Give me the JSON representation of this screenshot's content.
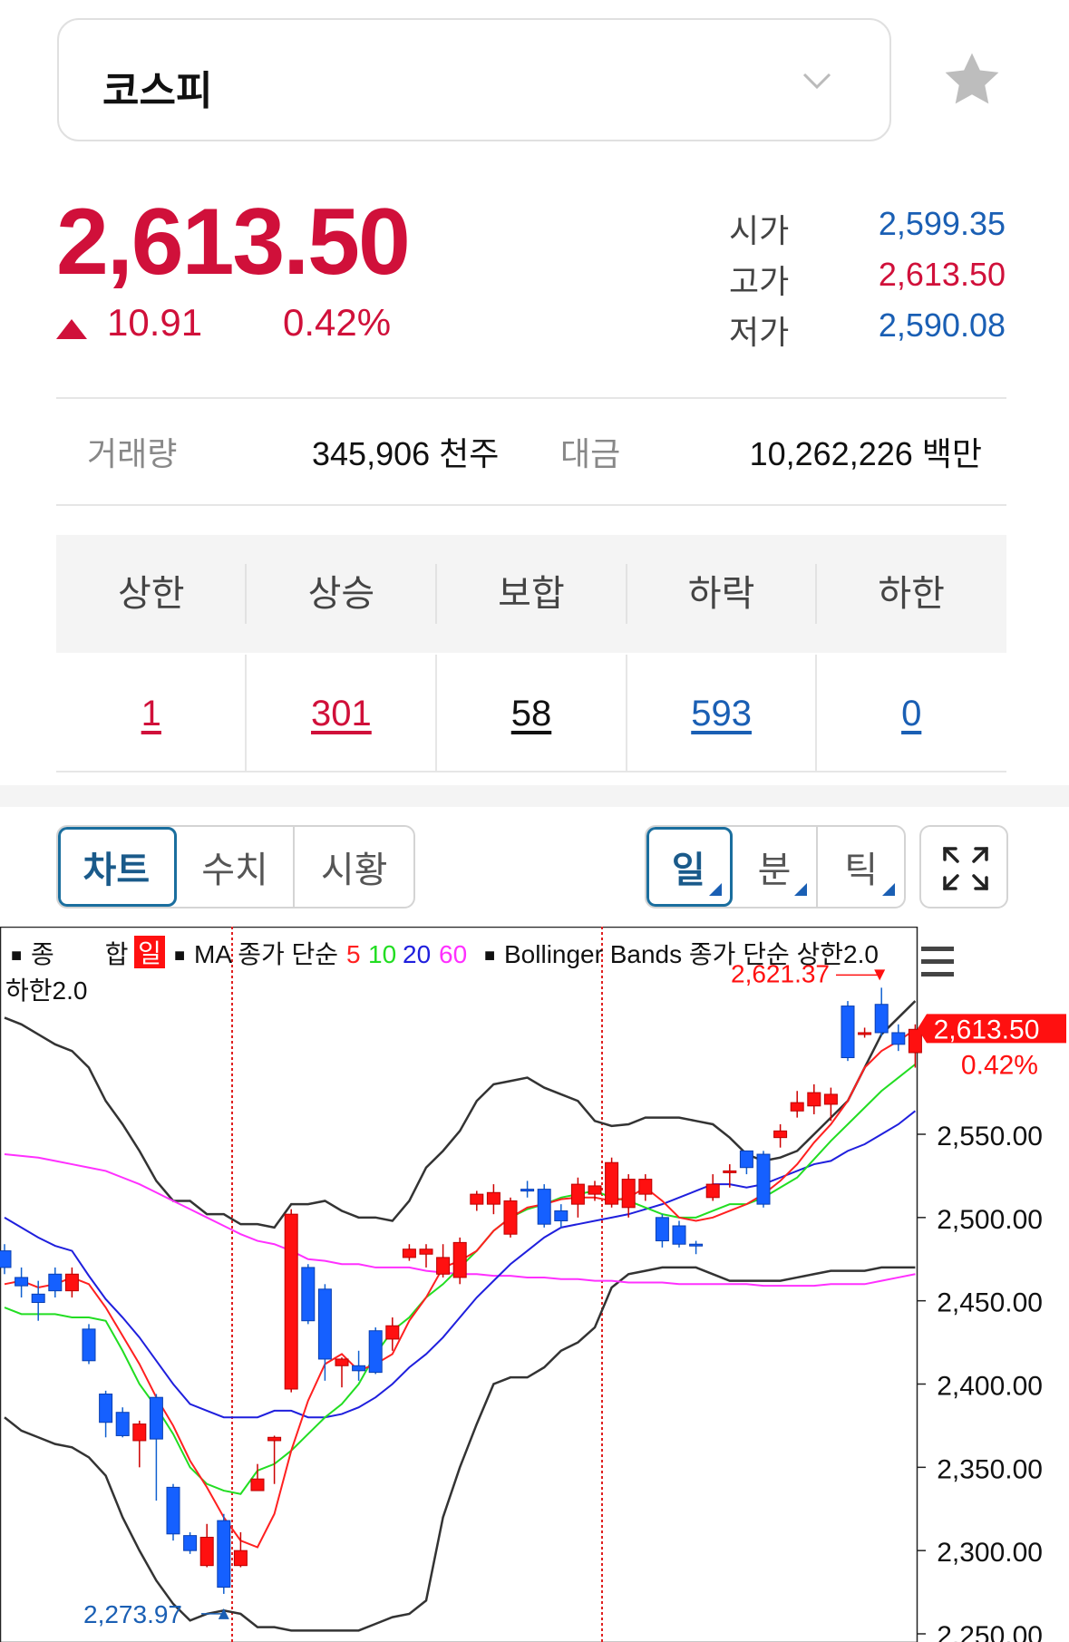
{
  "index": {
    "name": "코스피",
    "price": "2,613.50",
    "change": "10.91",
    "change_pct": "0.42%",
    "up_color": "#d0103a",
    "down_color": "#1a5fb4"
  },
  "ohl": {
    "open_label": "시가",
    "open": "2,599.35",
    "high_label": "고가",
    "high": "2,613.50",
    "low_label": "저가",
    "low": "2,590.08"
  },
  "volume": {
    "volume_label": "거래량",
    "volume": "345,906 천주",
    "amount_label": "대금",
    "amount": "10,262,226 백만"
  },
  "breadth": {
    "headers": [
      "상한",
      "상승",
      "보합",
      "하락",
      "하한"
    ],
    "values": [
      "1",
      "301",
      "58",
      "593",
      "0"
    ]
  },
  "view_tabs": [
    "차트",
    "수치",
    "시황"
  ],
  "period_tabs": [
    "일",
    "분",
    "틱"
  ],
  "chart_data": {
    "type": "candlestick",
    "legend": {
      "series_name": "종　　합",
      "period_badge": "일",
      "ma_text": "MA 종가 단순",
      "ma_periods": [
        "5",
        "10",
        "20",
        "60"
      ],
      "bb_text": "Bollinger Bands 종가 단순 상한2.0",
      "bb_text2": "하한2.0"
    },
    "ma_colors": [
      "#ff2020",
      "#22dd22",
      "#1f1fdd",
      "#ff30ff"
    ],
    "y_ticks": [
      "2,550.00",
      "2,500.00",
      "2,450.00",
      "2,400.00",
      "2,350.00",
      "2,300.00",
      "2,250.00"
    ],
    "y_tick_values": [
      2550,
      2500,
      2450,
      2400,
      2350,
      2300,
      2250
    ],
    "ylim": [
      2244,
      2648
    ],
    "last_price_label": "2,613.50",
    "last_pct_label": "0.42%",
    "max_label": "2,621.37",
    "min_label": "2,273.97",
    "candles": [
      [
        2480,
        2470,
        2484,
        2466
      ],
      [
        2464,
        2459,
        2470,
        2452
      ],
      [
        2454,
        2449,
        2462,
        2438
      ],
      [
        2466,
        2456,
        2470,
        2452
      ],
      [
        2456,
        2466,
        2470,
        2452
      ],
      [
        2433,
        2414,
        2436,
        2412
      ],
      [
        2394,
        2377,
        2396,
        2368
      ],
      [
        2383,
        2369,
        2386,
        2368
      ],
      [
        2366,
        2376,
        2378,
        2350
      ],
      [
        2392,
        2367,
        2394,
        2330
      ],
      [
        2338,
        2310,
        2340,
        2306
      ],
      [
        2309,
        2300,
        2311,
        2298
      ],
      [
        2291,
        2308,
        2316,
        2290
      ],
      [
        2318,
        2278,
        2322,
        2274
      ],
      [
        2291,
        2300,
        2311,
        2290
      ],
      [
        2336,
        2343,
        2352,
        2336
      ],
      [
        2366,
        2368,
        2369,
        2340
      ],
      [
        2397,
        2502,
        2505,
        2395
      ],
      [
        2470,
        2438,
        2472,
        2436
      ],
      [
        2457,
        2415,
        2460,
        2402
      ],
      [
        2411,
        2415,
        2416,
        2398
      ],
      [
        2411,
        2408,
        2420,
        2402
      ],
      [
        2432,
        2407,
        2434,
        2406
      ],
      [
        2427,
        2435,
        2440,
        2420
      ],
      [
        2476,
        2481,
        2484,
        2474
      ],
      [
        2478,
        2481,
        2484,
        2470
      ],
      [
        2466,
        2476,
        2484,
        2464
      ],
      [
        2464,
        2485,
        2488,
        2460
      ],
      [
        2508,
        2514,
        2516,
        2504
      ],
      [
        2508,
        2515,
        2520,
        2502
      ],
      [
        2490,
        2510,
        2512,
        2488
      ],
      [
        2517,
        2516,
        2522,
        2512
      ],
      [
        2517,
        2496,
        2520,
        2494
      ],
      [
        2504,
        2498,
        2508,
        2494
      ],
      [
        2508,
        2520,
        2524,
        2500
      ],
      [
        2514,
        2519,
        2522,
        2510
      ],
      [
        2508,
        2533,
        2536,
        2506
      ],
      [
        2506,
        2523,
        2526,
        2500
      ],
      [
        2514,
        2523,
        2526,
        2510
      ],
      [
        2500,
        2486,
        2502,
        2482
      ],
      [
        2495,
        2484,
        2498,
        2482
      ],
      [
        2484,
        2483,
        2486,
        2478
      ],
      [
        2512,
        2520,
        2526,
        2510
      ],
      [
        2528,
        2528,
        2532,
        2518
      ],
      [
        2540,
        2530,
        2540,
        2526
      ],
      [
        2538,
        2508,
        2540,
        2506
      ],
      [
        2548,
        2552,
        2556,
        2542
      ],
      [
        2564,
        2569,
        2576,
        2560
      ],
      [
        2567,
        2575,
        2580,
        2562
      ],
      [
        2568,
        2574,
        2578,
        2558
      ],
      [
        2627,
        2596,
        2630,
        2594
      ],
      [
        2610,
        2611,
        2614,
        2608
      ],
      [
        2628,
        2611,
        2638,
        2609
      ],
      [
        2611,
        2604,
        2616,
        2600
      ],
      [
        2599,
        2613,
        2616,
        2590
      ]
    ],
    "ma5": [
      2460,
      2462,
      2458,
      2460,
      2464,
      2460,
      2446,
      2429,
      2412,
      2392,
      2375,
      2354,
      2338,
      2320,
      2306,
      2302,
      2322,
      2360,
      2390,
      2412,
      2418,
      2408,
      2412,
      2418,
      2438,
      2452,
      2470,
      2474,
      2480,
      2492,
      2500,
      2506,
      2508,
      2511,
      2512,
      2512,
      2510,
      2512,
      2518,
      2510,
      2500,
      2498,
      2500,
      2504,
      2508,
      2514,
      2522,
      2532,
      2545,
      2556,
      2570,
      2590,
      2600,
      2606,
      2613
    ],
    "ma10": [
      2446,
      2442,
      2442,
      2442,
      2440,
      2440,
      2438,
      2420,
      2400,
      2386,
      2370,
      2350,
      2340,
      2336,
      2334,
      2348,
      2352,
      2360,
      2370,
      2380,
      2388,
      2400,
      2418,
      2432,
      2440,
      2452,
      2460,
      2470,
      2480,
      2492,
      2500,
      2505,
      2508,
      2512,
      2514,
      2516,
      2512,
      2510,
      2506,
      2502,
      2500,
      2500,
      2504,
      2508,
      2508,
      2512,
      2518,
      2524,
      2535,
      2546,
      2556,
      2566,
      2576,
      2584,
      2592
    ],
    "ma20": [
      2500,
      2494,
      2488,
      2483,
      2480,
      2465,
      2451,
      2440,
      2428,
      2414,
      2400,
      2388,
      2384,
      2380,
      2380,
      2380,
      2384,
      2384,
      2380,
      2380,
      2382,
      2386,
      2392,
      2400,
      2410,
      2418,
      2428,
      2440,
      2452,
      2462,
      2472,
      2480,
      2488,
      2494,
      2496,
      2498,
      2500,
      2502,
      2505,
      2508,
      2512,
      2516,
      2520,
      2520,
      2518,
      2520,
      2524,
      2528,
      2532,
      2534,
      2540,
      2544,
      2550,
      2556,
      2564
    ],
    "ma60": [
      2538,
      2537,
      2536,
      2534,
      2532,
      2530,
      2528,
      2524,
      2520,
      2515,
      2510,
      2505,
      2500,
      2495,
      2490,
      2486,
      2484,
      2480,
      2475,
      2474,
      2472,
      2472,
      2470,
      2470,
      2470,
      2468,
      2467,
      2466,
      2466,
      2465,
      2465,
      2464,
      2464,
      2463,
      2463,
      2462,
      2462,
      2461,
      2461,
      2461,
      2460,
      2460,
      2460,
      2460,
      2460,
      2459,
      2459,
      2459,
      2459,
      2460,
      2460,
      2460,
      2462,
      2464,
      2466
    ],
    "bb_upper": [
      2620,
      2616,
      2610,
      2604,
      2600,
      2590,
      2570,
      2556,
      2540,
      2522,
      2510,
      2510,
      2502,
      2502,
      2496,
      2496,
      2494,
      2508,
      2508,
      2510,
      2504,
      2500,
      2500,
      2498,
      2510,
      2530,
      2540,
      2552,
      2570,
      2580,
      2582,
      2584,
      2578,
      2574,
      2570,
      2558,
      2555,
      2556,
      2560,
      2560,
      2560,
      2558,
      2556,
      2548,
      2538,
      2534,
      2536,
      2540,
      2550,
      2560,
      2570,
      2590,
      2610,
      2620,
      2630
    ],
    "bb_lower": [
      2380,
      2372,
      2368,
      2364,
      2362,
      2356,
      2345,
      2320,
      2300,
      2282,
      2268,
      2258,
      2262,
      2264,
      2262,
      2254,
      2254,
      2252,
      2252,
      2252,
      2252,
      2252,
      2256,
      2260,
      2262,
      2270,
      2320,
      2350,
      2376,
      2400,
      2404,
      2404,
      2410,
      2420,
      2425,
      2434,
      2458,
      2466,
      2468,
      2470,
      2470,
      2470,
      2466,
      2462,
      2462,
      2462,
      2462,
      2464,
      2466,
      2468,
      2468,
      2468,
      2470,
      2470,
      2470
    ]
  }
}
